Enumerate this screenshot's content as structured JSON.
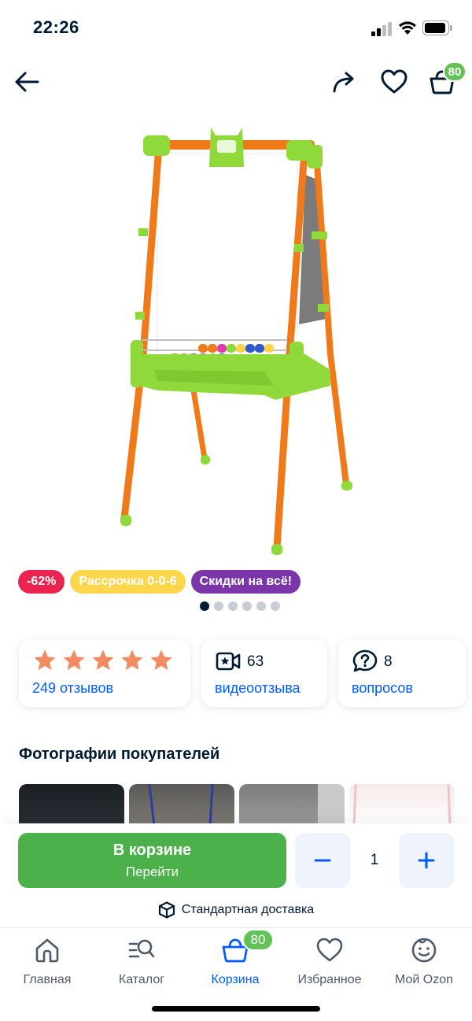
{
  "status_bar": {
    "time": "22:26"
  },
  "header": {
    "cart_badge": "80"
  },
  "product": {
    "image_alt": "",
    "badges": [
      {
        "label": "-62%",
        "color": "#e8244f"
      },
      {
        "label": "Рассрочка 0-0-6",
        "color": "#fcd64b"
      },
      {
        "label": "Скидки на всё!",
        "color": "#7a35a8"
      }
    ],
    "gallery": {
      "count": 6,
      "active_index": 0
    }
  },
  "stats": {
    "rating": {
      "stars": 5,
      "reviews_label": "249 отзывов"
    },
    "video": {
      "count": "63",
      "label": "видеоотзыва"
    },
    "questions": {
      "count": "8",
      "label": "вопросов"
    }
  },
  "buyer_photos": {
    "title": "Фотографии покупателей"
  },
  "purchase": {
    "in_cart_title": "В корзине",
    "in_cart_sub": "Перейти",
    "quantity": "1",
    "delivery_label": "Стандартная доставка"
  },
  "tab_bar": {
    "cart_badge": "80",
    "tabs": [
      {
        "label": "Главная",
        "icon": "home-icon"
      },
      {
        "label": "Каталог",
        "icon": "catalog-icon"
      },
      {
        "label": "Корзина",
        "icon": "basket-icon",
        "active": true
      },
      {
        "label": "Избранное",
        "icon": "heart-icon"
      },
      {
        "label": "Мой Ozon",
        "icon": "profile-icon"
      }
    ]
  },
  "colors": {
    "accent_blue": "#005bff",
    "green": "#4cb04b",
    "badge_green": "#62c256",
    "star_orange": "#f28a62"
  }
}
